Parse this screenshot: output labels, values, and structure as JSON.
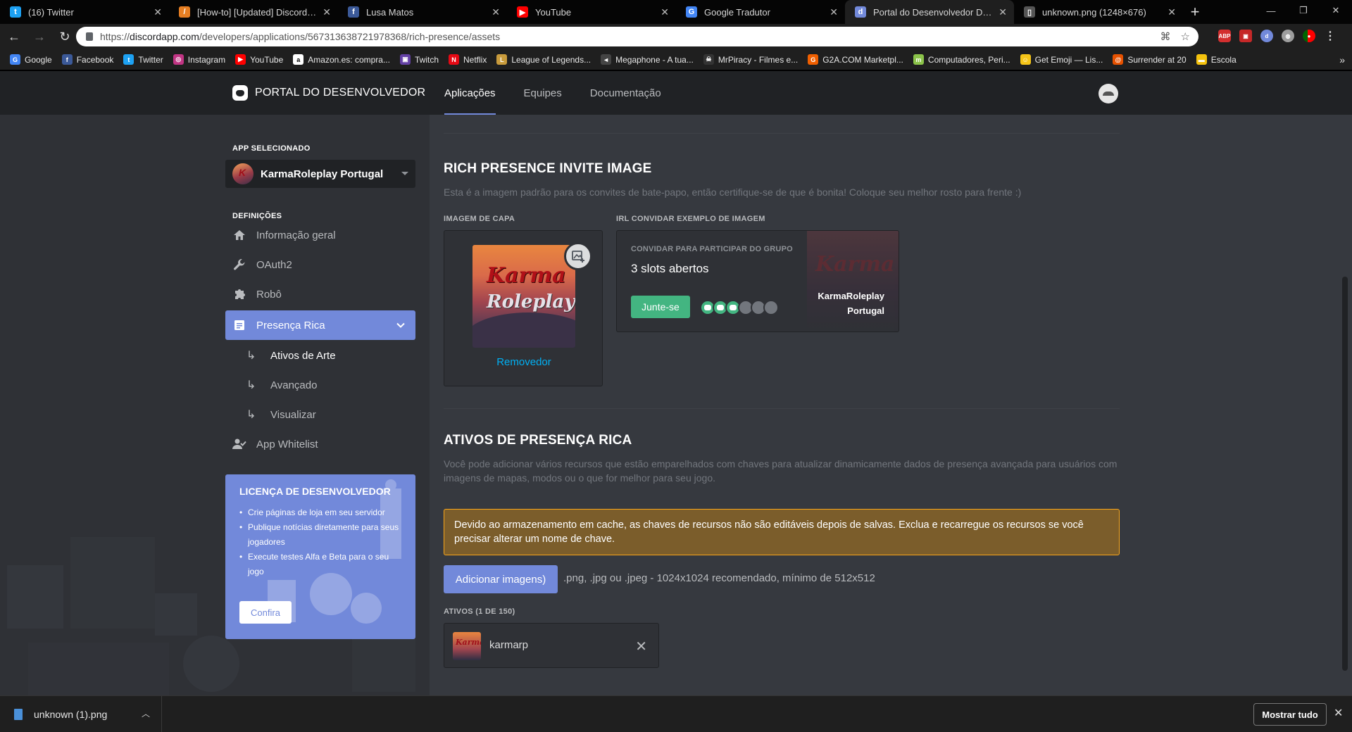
{
  "browser": {
    "tabs": [
      {
        "label": "(16) Twitter",
        "icon": "twitter-icon",
        "color": "#1da1f2",
        "glyph": "t"
      },
      {
        "label": "[How-to] [Updated] Discord rich",
        "icon": "alert-icon",
        "color": "#e67e22",
        "glyph": "/"
      },
      {
        "label": "Lusa Matos",
        "icon": "facebook-icon",
        "color": "#3b5998",
        "glyph": "f"
      },
      {
        "label": "YouTube",
        "icon": "youtube-icon",
        "color": "#ff0000",
        "glyph": "▶"
      },
      {
        "label": "Google Tradutor",
        "icon": "translate-icon",
        "color": "#4285f4",
        "glyph": "G"
      },
      {
        "label": "Portal do Desenvolvedor Discord",
        "icon": "discord-icon",
        "color": "#7289da",
        "glyph": "d"
      },
      {
        "label": "unknown.png (1248×676)",
        "icon": "file-icon",
        "color": "#555555",
        "glyph": "▯"
      }
    ],
    "active_tab": 5,
    "url_prefix": "https://",
    "url_host": "discordapp.com",
    "url_path": "/developers/applications/567313638721978368/rich-presence/assets",
    "bookmarks": [
      {
        "label": "Google",
        "color": "#4285f4",
        "glyph": "G"
      },
      {
        "label": "Facebook",
        "color": "#3b5998",
        "glyph": "f"
      },
      {
        "label": "Twitter",
        "color": "#1da1f2",
        "glyph": "t"
      },
      {
        "label": "Instagram",
        "color": "#c13584",
        "glyph": "◎"
      },
      {
        "label": "YouTube",
        "color": "#ff0000",
        "glyph": "▶"
      },
      {
        "label": "Amazon.es: compra...",
        "color": "#ffffff",
        "glyph": "a"
      },
      {
        "label": "Twitch",
        "color": "#6441a5",
        "glyph": "▣"
      },
      {
        "label": "Netflix",
        "color": "#e50914",
        "glyph": "N"
      },
      {
        "label": "League of Legends...",
        "color": "#c89b3c",
        "glyph": "L"
      },
      {
        "label": "Megaphone - A tua...",
        "color": "#444444",
        "glyph": "◄"
      },
      {
        "label": "MrPiracy - Filmes e...",
        "color": "#333333",
        "glyph": "☠"
      },
      {
        "label": "G2A.COM Marketpl...",
        "color": "#f05f00",
        "glyph": "G"
      },
      {
        "label": "Computadores, Peri...",
        "color": "#8bc34a",
        "glyph": "m"
      },
      {
        "label": "Get Emoji — Lis...",
        "color": "#f5c518",
        "glyph": "☺"
      },
      {
        "label": "Surrender at 20",
        "color": "#e65100",
        "glyph": "@"
      },
      {
        "label": "Escola",
        "color": "#f4c20d",
        "glyph": "▬"
      }
    ],
    "download_file": "unknown (1).png",
    "show_all": "Mostrar tudo"
  },
  "portal": {
    "brand": "PORTAL DO DESENVOLVEDOR",
    "nav": [
      "Aplicações",
      "Equipes",
      "Documentação"
    ],
    "active_nav": 0
  },
  "sidebar": {
    "selected_app_heading": "APP SELECIONADO",
    "app_name": "KarmaRoleplay Portugal",
    "settings_heading": "DEFINIÇÕES",
    "items": [
      {
        "label": "Informação geral"
      },
      {
        "label": "OAuth2"
      },
      {
        "label": "Robô"
      },
      {
        "label": "Presença Rica"
      },
      {
        "label": "App Whitelist"
      }
    ],
    "sub_items": [
      {
        "label": "Ativos de Arte"
      },
      {
        "label": "Avançado"
      },
      {
        "label": "Visualizar"
      }
    ],
    "license": {
      "title": "LICENÇA DE DESENVOLVEDOR",
      "bullets": [
        "Crie páginas de loja em seu servidor",
        "Publique notícias diretamente para seus jogadores",
        "Execute testes Alfa e Beta para o seu jogo"
      ],
      "button": "Confira"
    }
  },
  "main": {
    "invite_section": {
      "title": "RICH PRESENCE INVITE IMAGE",
      "description": "Esta é a imagem padrão para os convites de bate-papo, então certifique-se de que é bonita! Coloque seu melhor rosto para frente :)",
      "cover_label": "IMAGEM DE CAPA",
      "cover_remove": "Removedor",
      "cover_text_1": "Karma",
      "cover_text_2": "Roleplay",
      "example_label": "IRL CONVIDAR EXEMPLO DE IMAGEM",
      "invite_title": "CONVIDAR PARA PARTICIPAR DO GRUPO",
      "invite_slots": "3 slots abertos",
      "join_button": "Junte-se",
      "invite_app_line1": "KarmaRoleplay",
      "invite_app_line2": "Portugal",
      "slots_filled": 3,
      "slots_total": 6
    },
    "assets_section": {
      "title": "ATIVOS DE PRESENÇA RICA",
      "description": "Você pode adicionar vários recursos que estão emparelhados com chaves para atualizar dinamicamente dados de presença avançada para usuários com imagens de mapas, modos ou o que for melhor para seu jogo.",
      "warning": "Devido ao armazenamento em cache, as chaves de recursos não são editáveis depois de salvas. Exclua e recarregue os recursos se você precisar alterar um nome de chave.",
      "add_button": "Adicionar imagens)",
      "add_hint": ".png, .jpg ou .jpeg - 1024x1024 recomendado, mínimo de 512x512",
      "assets_label": "ATIVOS (1 DE 150)",
      "assets": [
        {
          "name": "karmarp"
        }
      ]
    }
  },
  "colors": {
    "blurple": "#7289da",
    "green": "#43b581",
    "warning_border": "#faa61a",
    "link": "#00b0f4"
  }
}
